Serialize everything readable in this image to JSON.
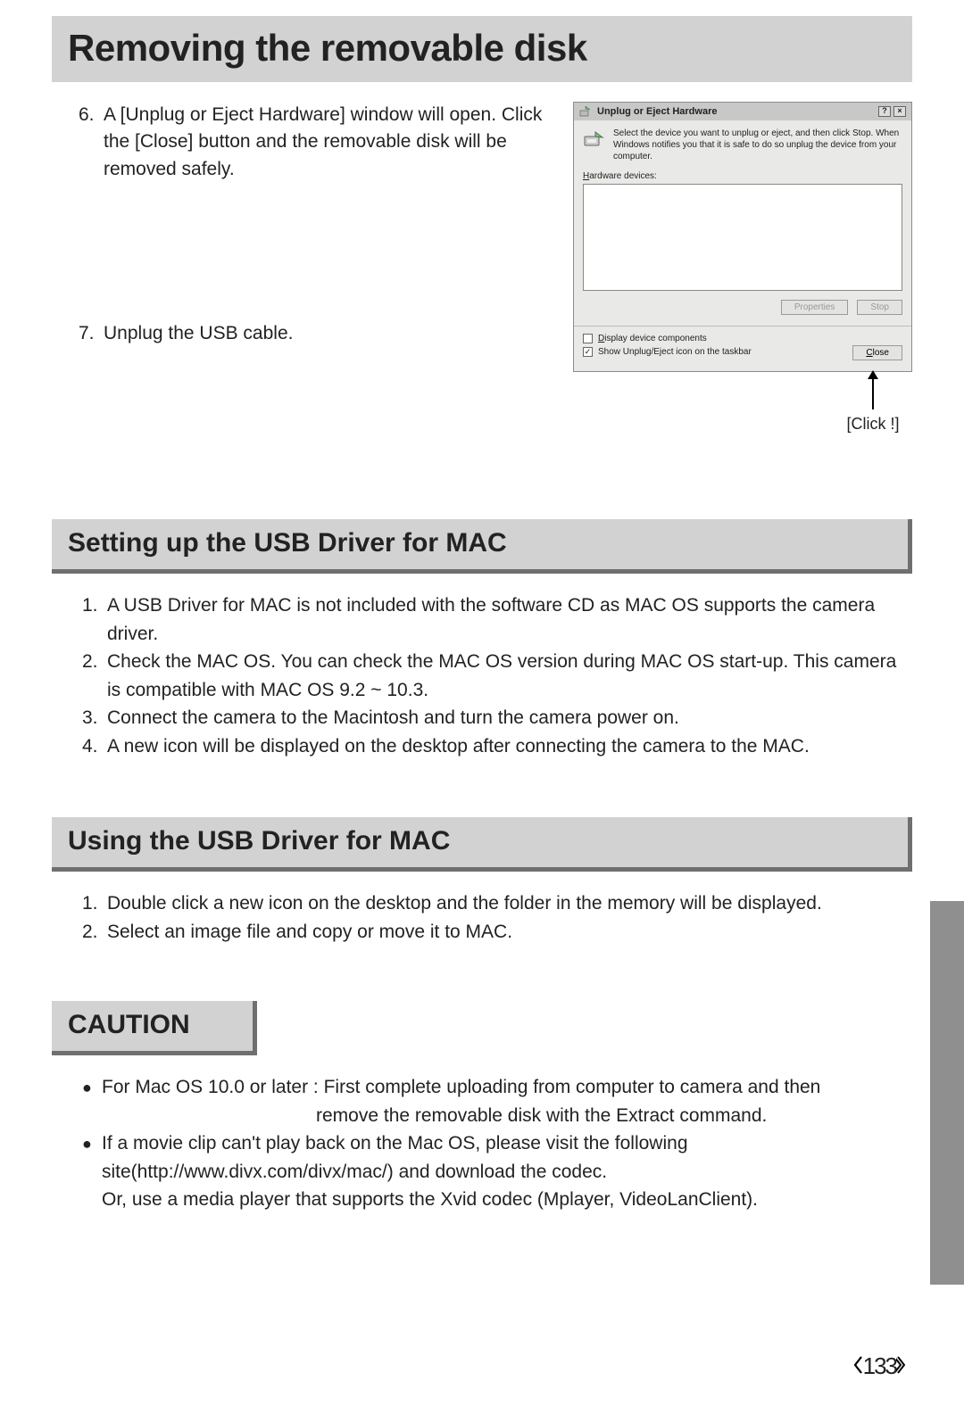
{
  "title": "Removing the removable disk",
  "step6": {
    "num": "6.",
    "text": "A [Unplug or Eject Hardware] window will open. Click the [Close] button and the removable disk will be removed safely."
  },
  "step7": {
    "num": "7.",
    "text": "Unplug the USB cable."
  },
  "dialog": {
    "title": "Unplug or Eject Hardware",
    "help_btn": "?",
    "close_btn": "×",
    "instruct": "Select the device you want to unplug or eject, and then click Stop. When Windows notifies you that it is safe to do so unplug the device from your computer.",
    "hw_label_pre": "H",
    "hw_label_rest": "ardware devices:",
    "btn_properties": "Properties",
    "btn_stop": "Stop",
    "chk1_pre": "D",
    "chk1_rest": "isplay device components",
    "chk2": "Show Unplug/Eject icon on the taskbar",
    "btn_close_pre": "C",
    "btn_close_rest": "lose"
  },
  "click_label": "[Click !]",
  "section2": {
    "header": "Setting up the USB Driver for MAC",
    "items": [
      {
        "n": "1.",
        "t": "A USB Driver for MAC is not included with the software CD as MAC OS supports the camera driver."
      },
      {
        "n": "2.",
        "t": "Check the MAC OS. You can check the MAC OS version during MAC OS start-up. This camera is compatible with MAC OS 9.2 ~ 10.3."
      },
      {
        "n": "3.",
        "t": "Connect the camera to the Macintosh and turn the camera power on."
      },
      {
        "n": "4.",
        "t": "A new icon will be displayed on the desktop after connecting the camera to the MAC."
      }
    ]
  },
  "section3": {
    "header": "Using the USB Driver for MAC",
    "items": [
      {
        "n": "1.",
        "t": "Double click a new icon on the desktop and the folder in the memory will be displayed."
      },
      {
        "n": "2.",
        "t": "Select an image file and copy or move it to MAC."
      }
    ]
  },
  "caution": {
    "header": "CAUTION",
    "b1_line1": "For Mac OS 10.0 or later : First complete uploading from computer to camera and then",
    "b1_line2": "remove the removable disk with the Extract command.",
    "b2_line1": "If a movie clip can't play back on the Mac OS, please visit the following",
    "b2_line2": "site(http://www.divx.com/divx/mac/) and download the codec.",
    "b2_line3": "Or, use a media player that supports the Xvid codec (Mplayer, VideoLanClient)."
  },
  "page_number": "133"
}
